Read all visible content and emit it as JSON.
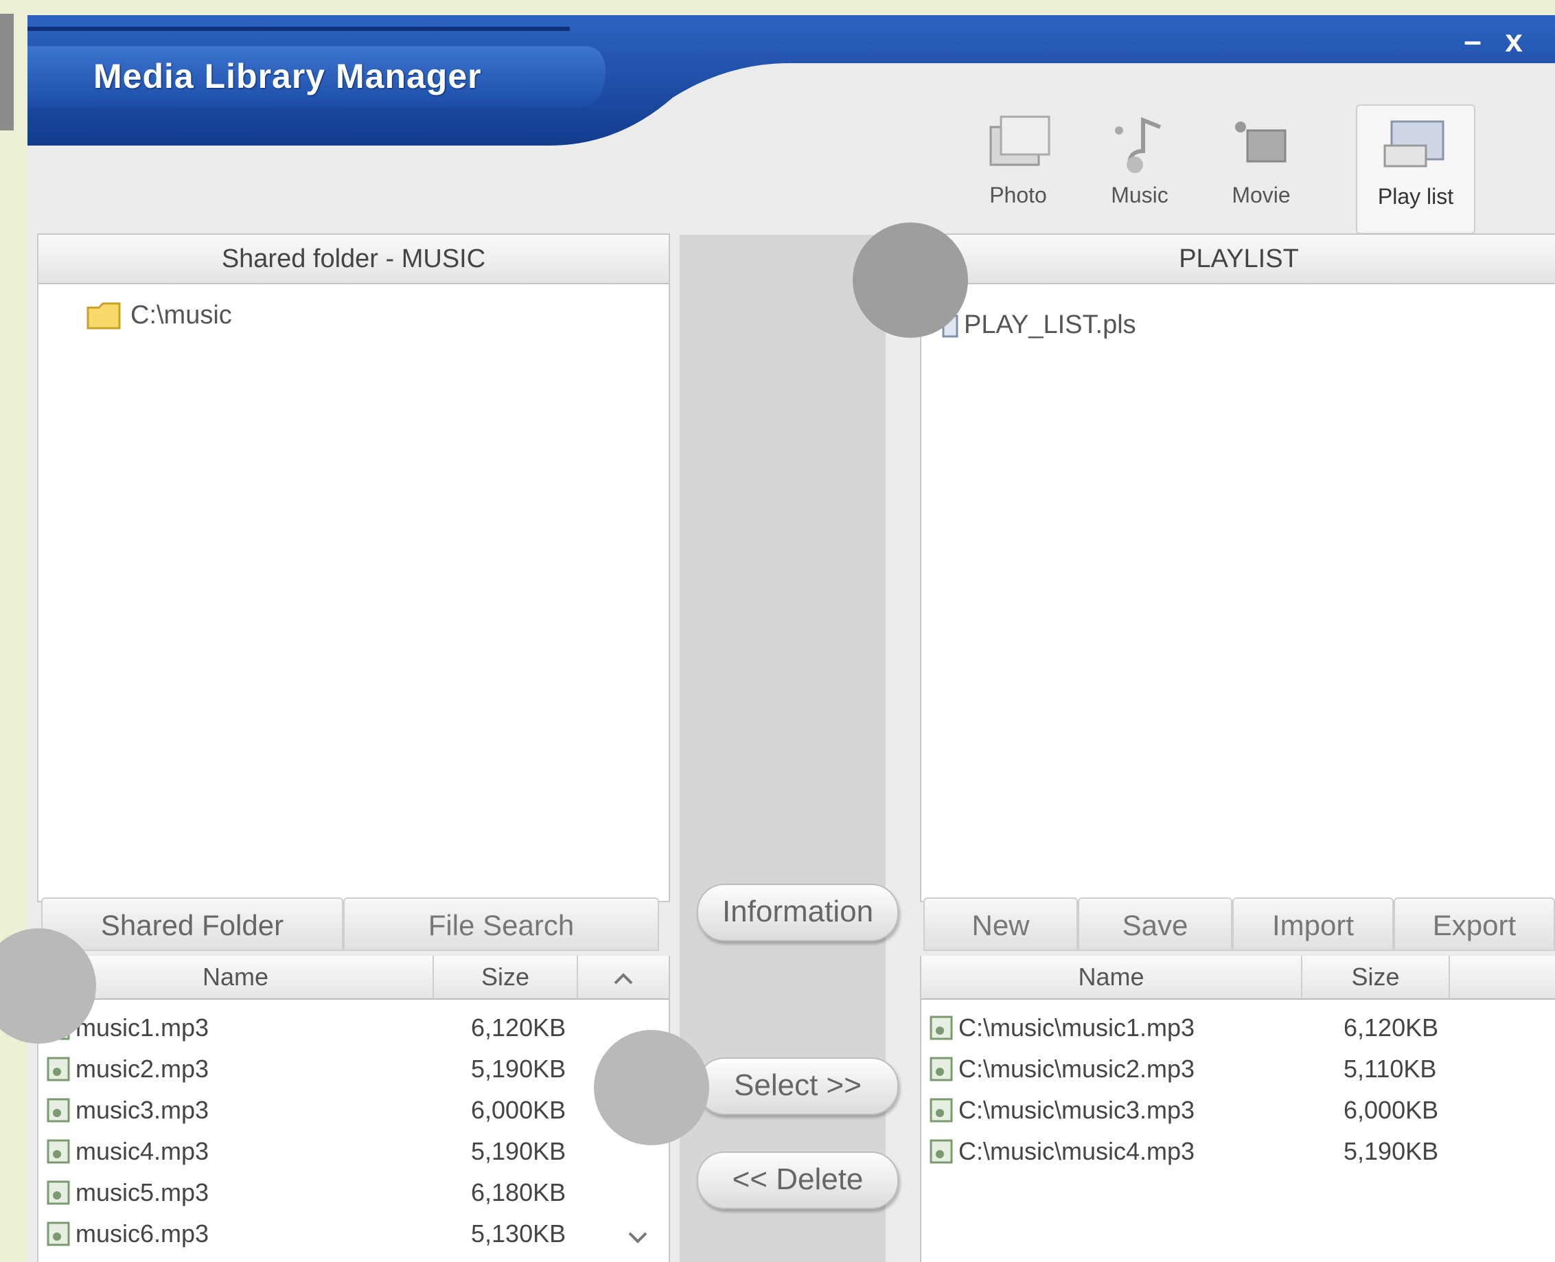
{
  "window": {
    "title": "Media Library Manager",
    "minimize": "–",
    "close": "x"
  },
  "modes": [
    {
      "label": "Photo",
      "icon": "photo-icon"
    },
    {
      "label": "Music",
      "icon": "music-icon"
    },
    {
      "label": "Movie",
      "icon": "movie-icon"
    },
    {
      "label": "Play list",
      "icon": "playlist-icon",
      "active": true
    }
  ],
  "left_panel": {
    "header": "Shared folder - MUSIC",
    "tree": [
      {
        "label": "C:\\music",
        "icon": "folder-icon"
      }
    ]
  },
  "right_panel": {
    "header": "PLAYLIST",
    "tree": [
      {
        "label": "PLAY_LIST.pls",
        "icon": "playlist-file-icon"
      }
    ]
  },
  "left_tabs": [
    "Shared Folder",
    "File Search"
  ],
  "right_tabs": [
    "New",
    "Save",
    "Import",
    "Export"
  ],
  "left_list": {
    "columns": [
      "Name",
      "Size"
    ],
    "rows": [
      {
        "name": "music1.mp3",
        "size": "6,120KB"
      },
      {
        "name": "music2.mp3",
        "size": "5,190KB"
      },
      {
        "name": "music3.mp3",
        "size": "6,000KB"
      },
      {
        "name": "music4.mp3",
        "size": "5,190KB"
      },
      {
        "name": "music5.mp3",
        "size": "6,180KB"
      },
      {
        "name": "music6.mp3",
        "size": "5,130KB"
      }
    ]
  },
  "right_list": {
    "columns": [
      "Name",
      "Size"
    ],
    "rows": [
      {
        "name": "C:\\music\\music1.mp3",
        "size": "6,120KB"
      },
      {
        "name": "C:\\music\\music2.mp3",
        "size": "5,110KB"
      },
      {
        "name": "C:\\music\\music3.mp3",
        "size": "6,000KB"
      },
      {
        "name": "C:\\music\\music4.mp3",
        "size": "5,190KB"
      }
    ]
  },
  "buttons": {
    "information": "Information",
    "select": "Select >>",
    "delete": "<< Delete"
  },
  "colors": {
    "title_bar": "#1c4fa8",
    "background": "#ececec"
  }
}
